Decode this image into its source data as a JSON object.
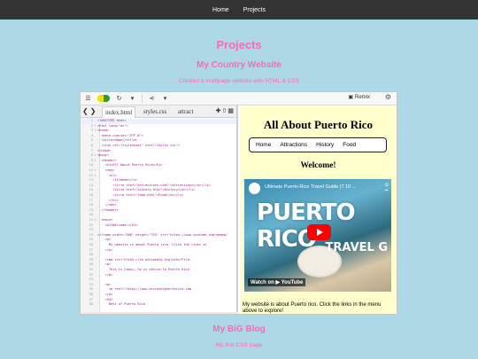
{
  "nav": {
    "items": [
      "Home",
      "Projects"
    ]
  },
  "page": {
    "title": "Projects"
  },
  "projects": [
    {
      "title": "My Country Website",
      "description": "Created a multipage website with HTML & CSS"
    },
    {
      "title": "My BiG Blog",
      "description": "My first CSS page"
    }
  ],
  "embed": {
    "toolbar": {
      "remix_label": "Remix"
    },
    "files": [
      "index.html",
      "styles.css",
      "attract"
    ],
    "active_file": "index.html",
    "code_lines": [
      {
        "n": "1",
        "fold": "",
        "text": "<!DOCTYPE html>"
      },
      {
        "n": "2",
        "fold": "▾",
        "text": "<html lang=\"en\">"
      },
      {
        "n": "3",
        "fold": "▾",
        "text": "<head>"
      },
      {
        "n": "4",
        "fold": "",
        "text": "  <meta charset=\"UTF-8\">"
      },
      {
        "n": "5",
        "fold": "",
        "text": "  <title>Home</title>"
      },
      {
        "n": "6",
        "fold": "",
        "text": "  <link rel=\"stylesheet\" href=\"styles.css\">"
      },
      {
        "n": "7",
        "fold": "",
        "text": "</head>"
      },
      {
        "n": "8",
        "fold": "▾",
        "text": "<body>"
      },
      {
        "n": "9",
        "fold": "▾",
        "text": "  <header>"
      },
      {
        "n": "10",
        "fold": "",
        "text": "    <h1>All About Puerto Rico</h1>"
      },
      {
        "n": "11",
        "fold": "▾",
        "text": "    <nav>"
      },
      {
        "n": "12",
        "fold": "▾",
        "text": "      <ul>"
      },
      {
        "n": "13",
        "fold": "",
        "text": "        <li>Home</li>"
      },
      {
        "n": "14",
        "fold": "",
        "text": "        <li><a href=\"attractions.html\">Attractions</a></li>"
      },
      {
        "n": "15",
        "fold": "",
        "text": "        <li><a href=\"history.html\">History</a></li>"
      },
      {
        "n": "16",
        "fold": "",
        "text": "        <li><a href=\"food.html\">Food</a></li>"
      },
      {
        "n": "17",
        "fold": "",
        "text": "      </ul>"
      },
      {
        "n": "18",
        "fold": "",
        "text": "    </nav>"
      },
      {
        "n": "19",
        "fold": "",
        "text": "  </header>"
      },
      {
        "n": "20",
        "fold": "",
        "text": ""
      },
      {
        "n": "21",
        "fold": "▾",
        "text": "  <main>"
      },
      {
        "n": "22",
        "fold": "",
        "text": "    <h2>Welcome!</h2>"
      },
      {
        "n": "23",
        "fold": "",
        "text": ""
      },
      {
        "n": "24",
        "fold": "",
        "text": "<iframe width=\"560\" height=\"315\" src=\"https://www.youtube.com/embed/"
      },
      {
        "n": "25",
        "fold": "",
        "text": "    <p>"
      },
      {
        "n": "26",
        "fold": "",
        "text": "      My website is about Puerto rico. Click the links in"
      },
      {
        "n": "27",
        "fold": "",
        "text": "    </p>"
      },
      {
        "n": "28",
        "fold": "",
        "text": ""
      },
      {
        "n": "29",
        "fold": "",
        "text": "    <img src=\"https://es.wikipedia.org/wiki/File:"
      },
      {
        "n": "30",
        "fold": "",
        "text": "    <p>"
      },
      {
        "n": "31",
        "fold": "",
        "text": "      This is Coqui, he is native to Puerto Rico"
      },
      {
        "n": "32",
        "fold": "",
        "text": "    </p>"
      },
      {
        "n": "33",
        "fold": "",
        "text": ""
      },
      {
        "n": "34",
        "fold": "",
        "text": "    <p>"
      },
      {
        "n": "35",
        "fold": "",
        "text": "      <a href=\"https://www.discoverpuertorico.com"
      },
      {
        "n": "36",
        "fold": "",
        "text": "    </p>"
      },
      {
        "n": "37",
        "fold": "",
        "text": "    <h3>"
      },
      {
        "n": "38",
        "fold": "",
        "text": "      Best of Puerto Rico"
      }
    ],
    "preview": {
      "heading": "All About Puerto Rico",
      "nav": [
        "Home",
        "Attractions",
        "History",
        "Food"
      ],
      "welcome": "Welcome!",
      "video_title": "Ultimate Puerto Rico Travel Guide (7 10 ...",
      "video_overlay": "PUERTO RICO",
      "video_overlay2": "TRAVEL G",
      "watch_on": "Watch on ▶ YouTube",
      "body_text": "My website is about Puerto rico. Click the links in the menu above to explore!"
    }
  },
  "colors": {
    "accent": "#ff69b4",
    "page_bg": "#add8e6",
    "nav_bg": "#333333",
    "preview_bg": "#ffffcc"
  }
}
